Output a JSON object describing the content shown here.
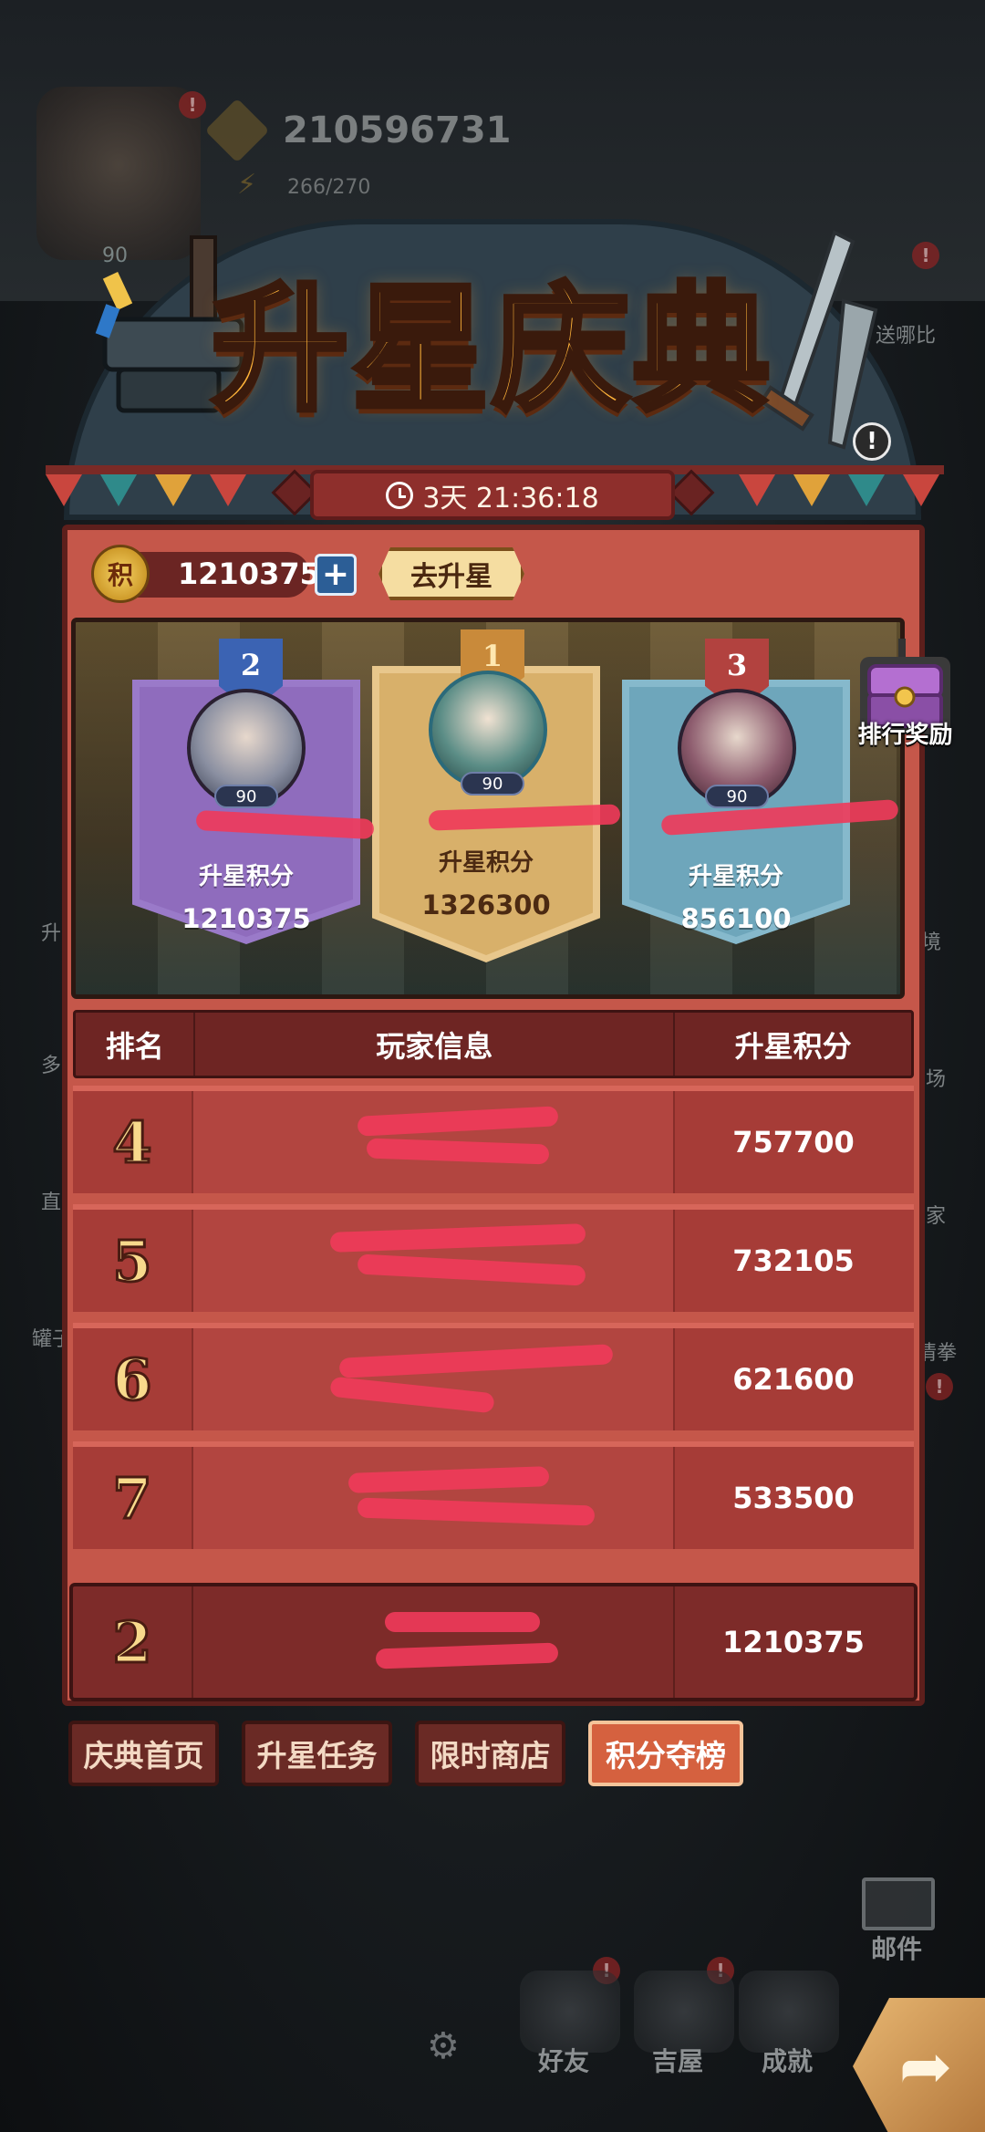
{
  "background": {
    "resource_value": "210596731",
    "energy_value": "266/270",
    "hero_level": "90",
    "side_labels": [
      "送哪比",
      "境",
      "场",
      "家",
      "情拳",
      "升",
      "多",
      "直",
      "罐子",
      "邮件"
    ],
    "badge_mark": "!"
  },
  "event": {
    "title": "升星庆典",
    "countdown": "3天 21:36:18"
  },
  "points": {
    "badge_text": "积",
    "value": "1210375",
    "plus_label": "+",
    "goto_label": "去升星"
  },
  "reward_button_label": "排行奖励",
  "podium": [
    {
      "rank": "2",
      "level": "90",
      "score_label": "升星积分",
      "score": "1210375"
    },
    {
      "rank": "1",
      "level": "90",
      "score_label": "升星积分",
      "score": "1326300"
    },
    {
      "rank": "3",
      "level": "90",
      "score_label": "升星积分",
      "score": "856100"
    }
  ],
  "table": {
    "headers": {
      "rank": "排名",
      "info": "玩家信息",
      "score": "升星积分"
    },
    "rows": [
      {
        "rank": "4",
        "score": "757700"
      },
      {
        "rank": "5",
        "score": "732105"
      },
      {
        "rank": "6",
        "score": "621600"
      },
      {
        "rank": "7",
        "score": "533500"
      }
    ],
    "self": {
      "rank": "2",
      "score": "1210375"
    }
  },
  "tabs": [
    {
      "label": "庆典首页",
      "active": false
    },
    {
      "label": "升星任务",
      "active": false
    },
    {
      "label": "限时商店",
      "active": false
    },
    {
      "label": "积分夺榜",
      "active": true
    }
  ],
  "bottom_nav": {
    "friends": "好友",
    "house": "吉屋",
    "achievements": "成就",
    "mail": "邮件"
  },
  "colors": {
    "panel": "#c5574a",
    "panel_border": "#5d1f1c",
    "title": "#ffb43a",
    "active_tab": "#d5613f",
    "redaction": "#f03a5a"
  }
}
